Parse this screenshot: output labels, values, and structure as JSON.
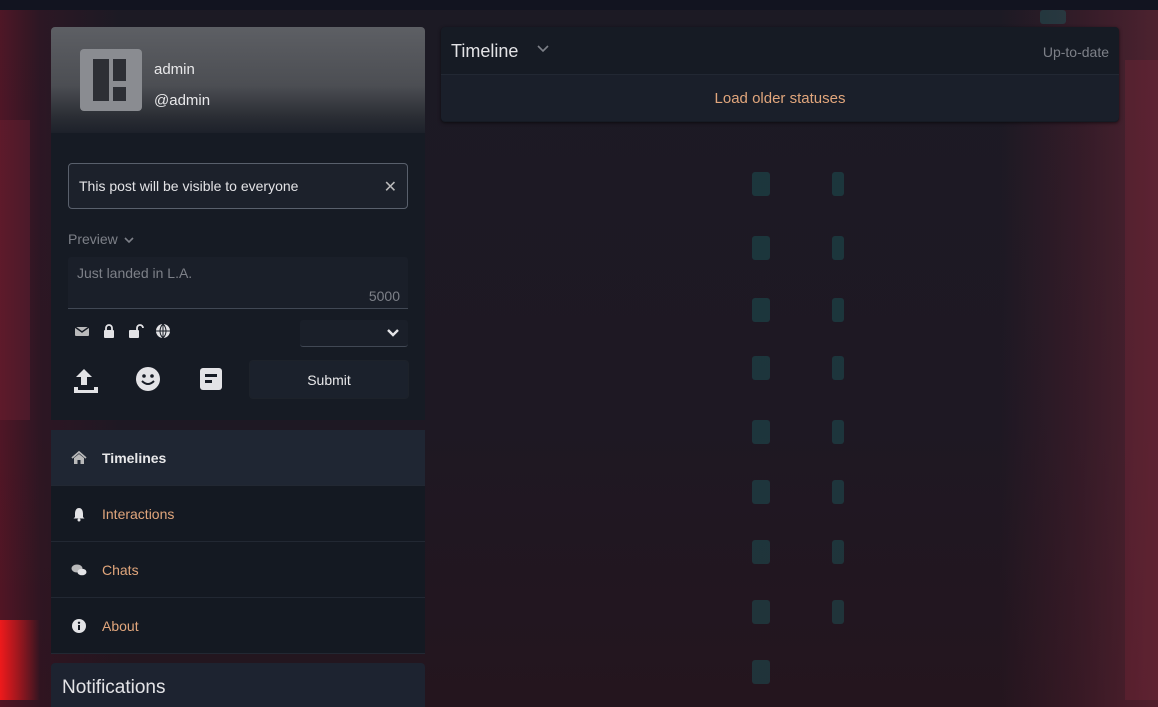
{
  "user": {
    "name": "admin",
    "handle": "@admin"
  },
  "post_form": {
    "visibility_notice": "This post will be visible to everyone",
    "close_symbol": "✕",
    "preview_label": "Preview",
    "textarea_placeholder": "Just landed in L.A.",
    "char_counter": "5000",
    "scope_icons": [
      "envelope-icon",
      "lock-icon",
      "unlock-icon",
      "globe-icon"
    ],
    "format_select_value": "",
    "submit_label": "Submit",
    "action_icons": [
      "upload-icon",
      "emoji-icon",
      "poll-icon"
    ]
  },
  "nav": {
    "items": [
      {
        "label": "Timelines",
        "icon": "home-icon",
        "active": true
      },
      {
        "label": "Interactions",
        "icon": "bell-icon",
        "active": false
      },
      {
        "label": "Chats",
        "icon": "chat-icon",
        "active": false
      },
      {
        "label": "About",
        "icon": "info-icon",
        "active": false
      }
    ]
  },
  "notifications": {
    "title": "Notifications"
  },
  "timeline": {
    "title": "Timeline",
    "status": "Up-to-date",
    "load_older_label": "Load older statuses"
  },
  "colors": {
    "accent": "#e1a67c",
    "panel": "#161b24",
    "text": "#e3e3e6",
    "muted": "#7d8088"
  }
}
